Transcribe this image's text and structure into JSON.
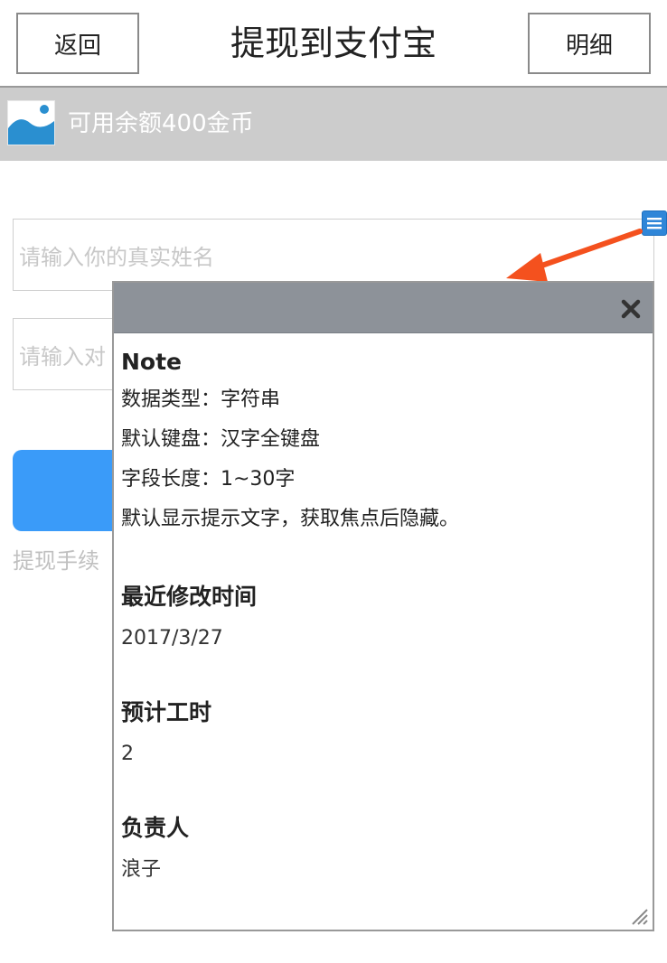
{
  "header": {
    "back_label": "返回",
    "title": "提现到支付宝",
    "detail_label": "明细"
  },
  "balance": {
    "text": "可用余额400金币",
    "icon": "image-placeholder-icon"
  },
  "form": {
    "name_placeholder": "请输入你的真实姓名",
    "account_placeholder_visible": "请输入对",
    "fee_text_visible": "提现手续"
  },
  "note_icon": "list-icon",
  "note_panel": {
    "heading": "Note",
    "lines": [
      "数据类型：字符串",
      "默认键盘：汉字全键盘",
      "字段长度：1~30字",
      "默认显示提示文字，获取焦点后隐藏。"
    ],
    "modified_label": "最近修改时间",
    "modified_value": "2017/3/27",
    "hours_label": "预计工时",
    "hours_value": "2",
    "owner_label": "负责人",
    "owner_value": "浪子",
    "close_icon": "close-icon"
  },
  "colors": {
    "primary_button": "#3a9bf9",
    "balance_bar": "#cccccc",
    "note_titlebar": "#8d9299",
    "arrow": "#f4511e",
    "note_icon": "#2f86d8"
  }
}
